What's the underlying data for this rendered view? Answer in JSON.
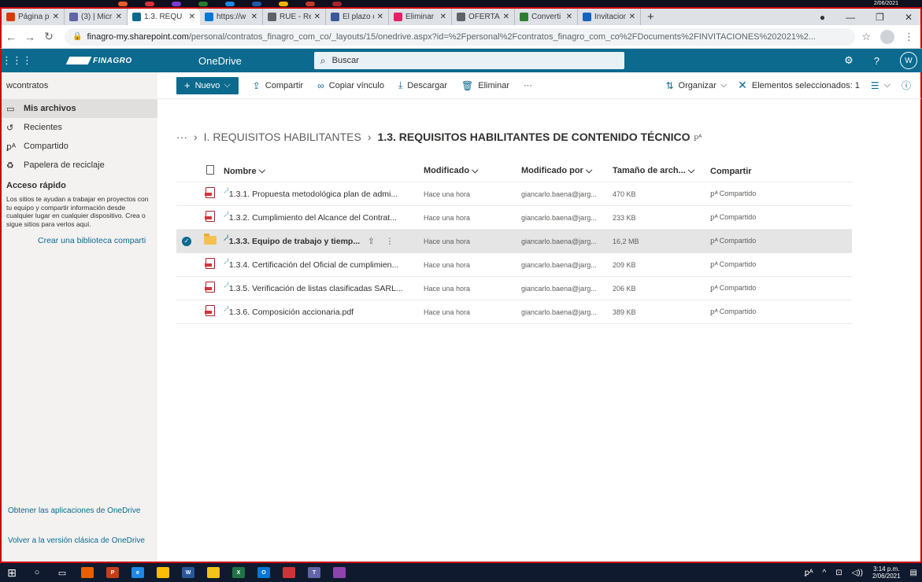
{
  "taskbar_top": {
    "clock": "2/06/2021",
    "colors": [
      "#e55b2a",
      "#d13438",
      "#7a3dcf",
      "#2b7a2b",
      "#1e88e5",
      "#1e5aa8",
      "#f0b400",
      "#c0392b",
      "#a4262c"
    ]
  },
  "browser": {
    "tabs": [
      {
        "label": "Página pr",
        "icon_color": "#d83b01",
        "icon": "office-icon"
      },
      {
        "label": "(3) | Micr",
        "icon_color": "#6264a7",
        "icon": "teams-icon"
      },
      {
        "label": "1.3. REQU",
        "icon_color": "#0b6a8e",
        "icon": "onedrive-icon",
        "active": true
      },
      {
        "label": "https://w",
        "icon_color": "#0078d4",
        "icon": "page-icon"
      },
      {
        "label": "RUE - Re",
        "icon_color": "#5f6368",
        "icon": "globe-icon"
      },
      {
        "label": "El plazo d",
        "icon_color": "#3b5998",
        "icon": "at-icon"
      },
      {
        "label": "Eliminar",
        "icon_color": "#e91e63",
        "icon": "grid-icon"
      },
      {
        "label": "OFERTA-",
        "icon_color": "#5f6368",
        "icon": "globe-icon"
      },
      {
        "label": "Converti",
        "icon_color": "#2e7d32",
        "icon": "convert-icon"
      },
      {
        "label": "Invitacion",
        "icon_color": "#1565c0",
        "icon": "arrow-icon"
      }
    ],
    "new_tab": "+",
    "url_host": "finagro-my.sharepoint.com",
    "url_path": "/personal/contratos_finagro_com_co/_layouts/15/onedrive.aspx?id=%2Fpersonal%2Fcontratos_finagro_com_co%2FDocuments%2FINVITACIONES%202021%2..."
  },
  "suite": {
    "logo": "FINAGRO",
    "app_name": "OneDrive",
    "search_placeholder": "Buscar",
    "avatar_initial": "W",
    "brand_color": "#0b6a8e"
  },
  "leftnav": {
    "user": "wcontratos",
    "items": [
      {
        "label": "Mis archivos",
        "icon": "folder-icon",
        "selected": true
      },
      {
        "label": "Recientes",
        "icon": "clock-icon"
      },
      {
        "label": "Compartido",
        "icon": "people-icon"
      },
      {
        "label": "Papelera de reciclaje",
        "icon": "trash-icon"
      }
    ],
    "quick_title": "Acceso rápido",
    "quick_desc": "Los sitios te ayudan a trabajar en proyectos con tu equipo y compartir información desde cualquier lugar en cualquier dispositivo. Crea o sigue sitios para verlos aquí.",
    "create_lib": "Crear una biblioteca comparti",
    "get_apps": "Obtener las aplicaciones de OneDrive",
    "classic": "Volver a la versión clásica de OneDrive"
  },
  "commandbar": {
    "new_label": "Nuevo",
    "share": "Compartir",
    "copy_link": "Copiar vínculo",
    "download": "Descargar",
    "delete": "Eliminar",
    "more": "···",
    "sort": "Organizar",
    "selected": "Elementos seleccionados: 1"
  },
  "breadcrumb": {
    "ellipsis": "···",
    "parent": "I. REQUISITOS HABILITANTES",
    "current": "1.3. REQUISITOS HABILITANTES DE CONTENIDO TÉCNICO"
  },
  "grid": {
    "columns": {
      "name": "Nombre",
      "modified": "Modificado",
      "modified_by": "Modificado por",
      "size": "Tamaño de arch...",
      "sharing": "Compartir"
    },
    "rows": [
      {
        "name": "1.3.1. Propuesta metodológica plan de admi...",
        "modified": "Hace una hora",
        "by": "giancarlo.baena@jarg...",
        "size": "470 KB",
        "sharing": "Compartido",
        "type": "pdf"
      },
      {
        "name": "1.3.2. Cumplimiento del Alcance del Contrat...",
        "modified": "Hace una hora",
        "by": "giancarlo.baena@jarg...",
        "size": "233 KB",
        "sharing": "Compartido",
        "type": "pdf"
      },
      {
        "name": "1.3.3. Equipo de trabajo y tiemp...",
        "modified": "Hace una hora",
        "by": "giancarlo.baena@jarg...",
        "size": "16,2 MB",
        "sharing": "Compartido",
        "type": "folder",
        "selected": true
      },
      {
        "name": "1.3.4. Certificación del Oficial de cumplimien...",
        "modified": "Hace una hora",
        "by": "giancarlo.baena@jarg...",
        "size": "209 KB",
        "sharing": "Compartido",
        "type": "pdf"
      },
      {
        "name": "1.3.5. Verificación de listas clasificadas SARL...",
        "modified": "Hace una hora",
        "by": "giancarlo.baena@jarg...",
        "size": "206 KB",
        "sharing": "Compartido",
        "type": "pdf"
      },
      {
        "name": "1.3.6. Composición accionaria.pdf",
        "modified": "Hace una hora",
        "by": "giancarlo.baena@jarg...",
        "size": "389 KB",
        "sharing": "Compartido",
        "type": "pdf"
      }
    ]
  },
  "taskbar": {
    "apps": [
      {
        "name": "windows-start-icon",
        "color": "#ffffff",
        "text": ""
      },
      {
        "name": "search-icon",
        "color": "#ffffff",
        "text": ""
      },
      {
        "name": "task-view-icon",
        "color": "#ffffff",
        "text": ""
      },
      {
        "name": "firefox-icon",
        "color": "#e66000",
        "text": ""
      },
      {
        "name": "powerpoint-icon",
        "color": "#c43e1c",
        "text": "P"
      },
      {
        "name": "edge-icon",
        "color": "#1e88e5",
        "text": "e"
      },
      {
        "name": "chrome-icon",
        "color": "#fbbc05",
        "text": ""
      },
      {
        "name": "word-icon",
        "color": "#2b579a",
        "text": "W"
      },
      {
        "name": "file-explorer-icon",
        "color": "#f0c419",
        "text": ""
      },
      {
        "name": "excel-icon",
        "color": "#217346",
        "text": "X"
      },
      {
        "name": "outlook-icon",
        "color": "#0078d4",
        "text": "O"
      },
      {
        "name": "acrobat-icon",
        "color": "#d13438",
        "text": ""
      },
      {
        "name": "teams-icon",
        "color": "#6264a7",
        "text": "T"
      },
      {
        "name": "app-icon",
        "color": "#8e44ad",
        "text": ""
      }
    ],
    "time": "3:14 p.m.",
    "date": "2/06/2021"
  }
}
